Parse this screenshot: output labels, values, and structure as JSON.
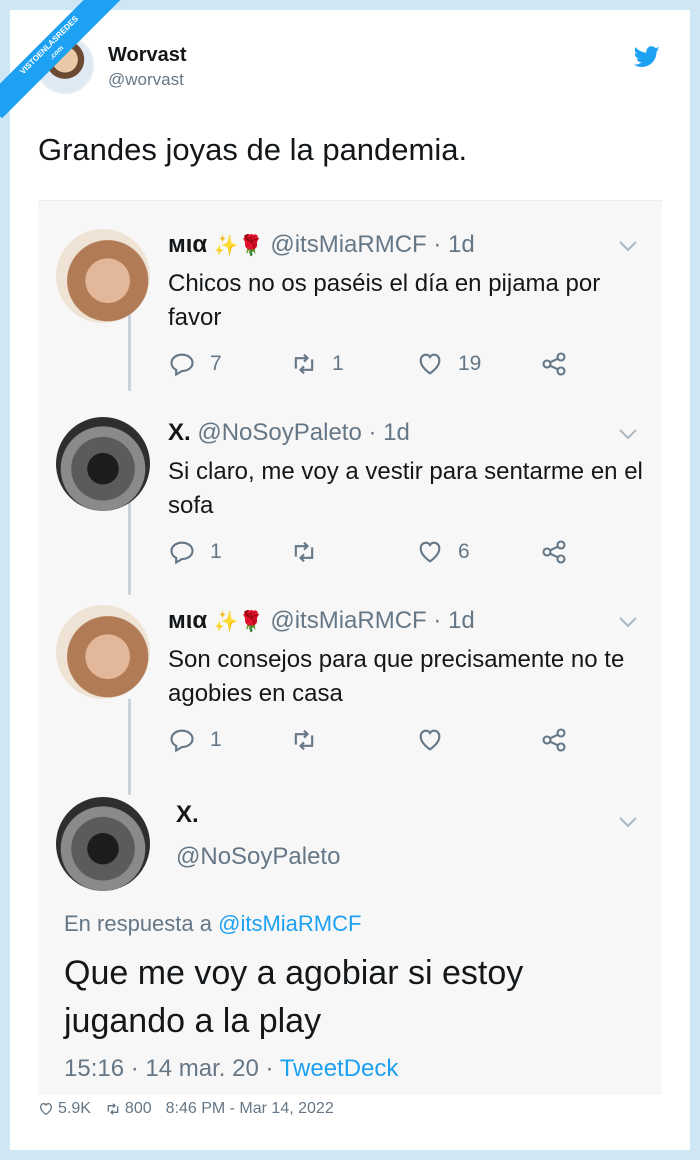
{
  "watermark": {
    "line1": "VISTOENLASREDES",
    "line2": ".com"
  },
  "author": {
    "name": "Worvast",
    "handle": "@worvast"
  },
  "tweet": {
    "text": "Grandes joyas de la pandemia."
  },
  "thread": [
    {
      "name": "мια",
      "emoji": "✨🌹",
      "handle_time": "@itsMiaRMCF · 1d",
      "body": "Chicos no os paséis el día en pijama por favor",
      "replies": "7",
      "retweets": "1",
      "likes": "19"
    },
    {
      "name": "X.",
      "emoji": "",
      "handle_time": "@NoSoyPaleto · 1d",
      "body": "Si claro, me voy a vestir para sentarme en el sofa",
      "replies": "1",
      "retweets": "",
      "likes": "6"
    },
    {
      "name": "мια",
      "emoji": "✨🌹",
      "handle_time": "@itsMiaRMCF · 1d",
      "body": "Son consejos para que precisamente no te agobies en casa",
      "replies": "1",
      "retweets": "",
      "likes": ""
    }
  ],
  "main_reply": {
    "name": "X.",
    "handle": "@NoSoyPaleto",
    "reply_prefix": "En respuesta a ",
    "reply_to": "@itsMiaRMCF",
    "text": "Que me voy a agobiar si estoy jugando a la play",
    "time": "15:16 · 14 mar. 20 · ",
    "source": "TweetDeck"
  },
  "footer": {
    "likes": "5.9K",
    "retweets": "800",
    "timestamp": "8:46 PM - Mar 14, 2022"
  },
  "colors": {
    "accent": "#1da1f2",
    "muted": "#657786",
    "background": "#cfe6f5"
  },
  "icons": [
    "twitter-bird-icon",
    "reply-icon",
    "retweet-icon",
    "heart-icon",
    "share-icon",
    "chevron-down-icon"
  ]
}
